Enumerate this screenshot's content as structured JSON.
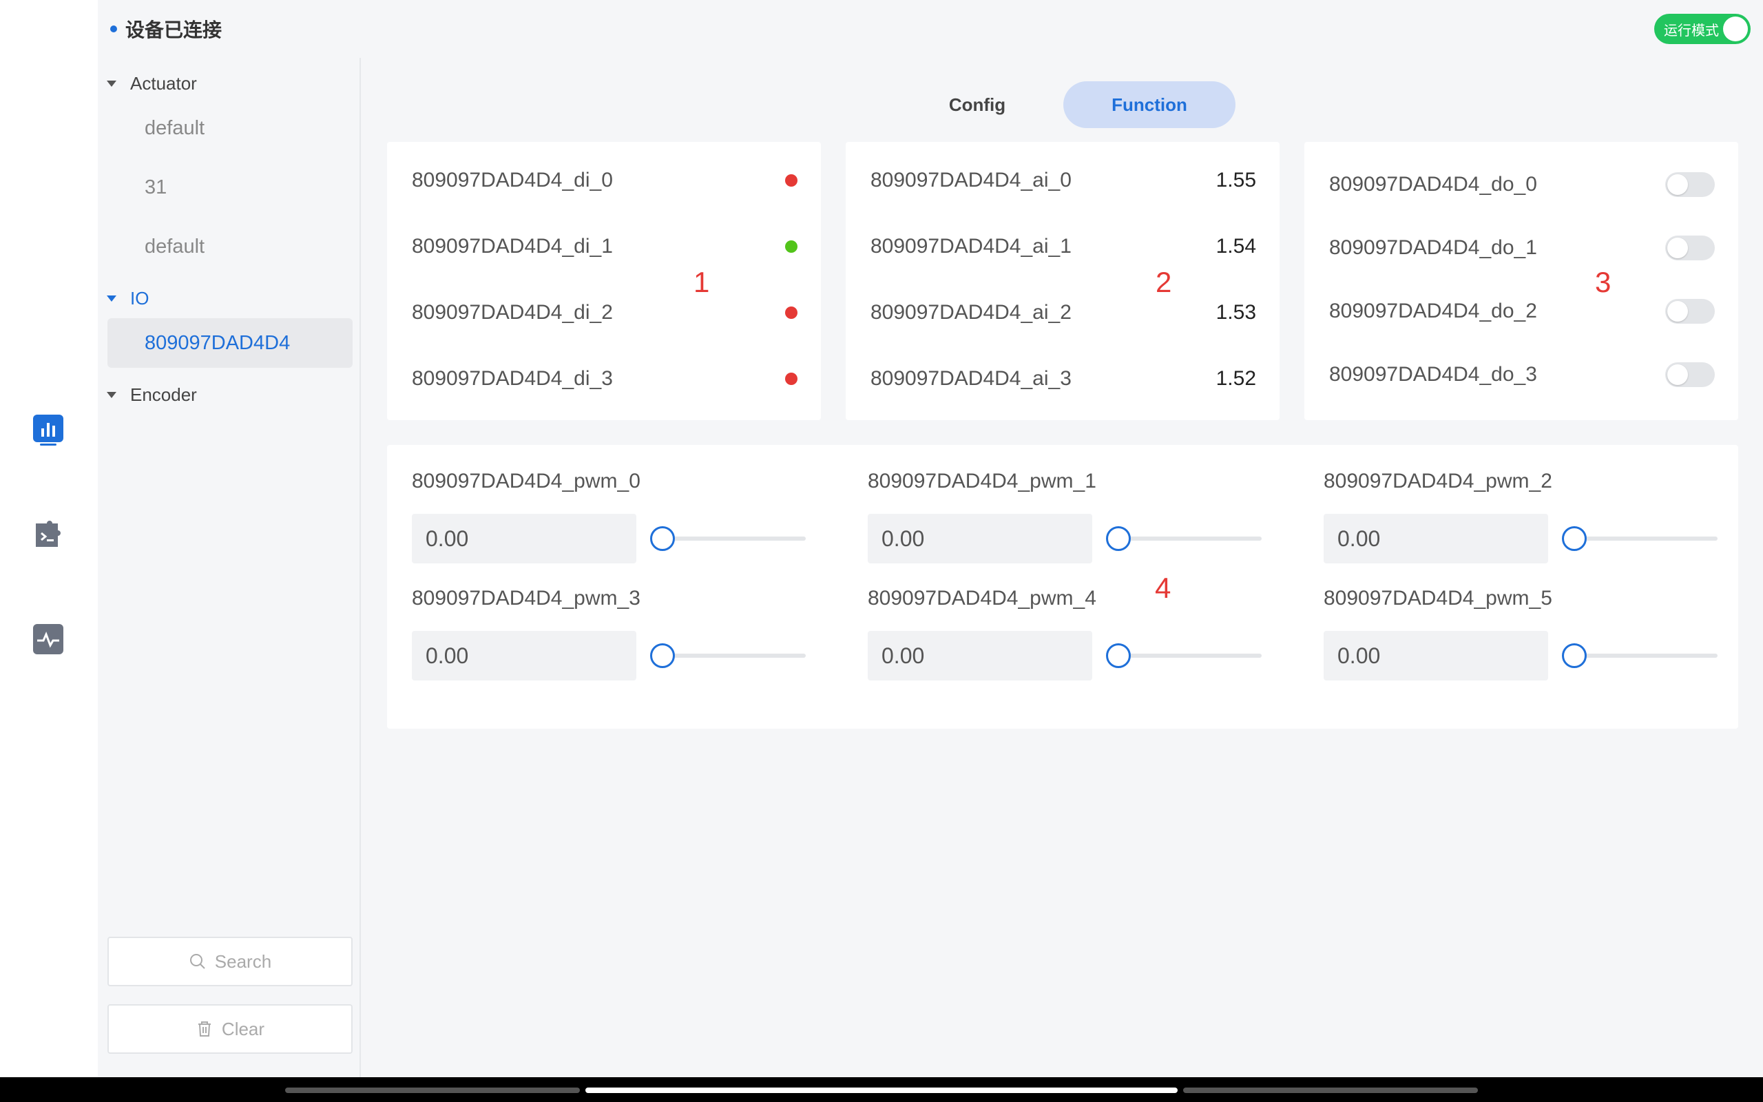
{
  "connection_status": "设备已连接",
  "mode_toggle_label": "运行模式",
  "tabs": [
    "Config",
    "Function"
  ],
  "tree": {
    "actuator_label": "Actuator",
    "actuator_items": [
      "default",
      "31",
      "default"
    ],
    "io_label": "IO",
    "io_items": [
      "809097DAD4D4"
    ],
    "encoder_label": "Encoder"
  },
  "sidebar_buttons": {
    "search": "Search",
    "clear": "Clear"
  },
  "di_panel": {
    "marker": "1",
    "rows": [
      {
        "name": "809097DAD4D4_di_0",
        "state": "red"
      },
      {
        "name": "809097DAD4D4_di_1",
        "state": "green"
      },
      {
        "name": "809097DAD4D4_di_2",
        "state": "red"
      },
      {
        "name": "809097DAD4D4_di_3",
        "state": "red"
      }
    ]
  },
  "ai_panel": {
    "marker": "2",
    "rows": [
      {
        "name": "809097DAD4D4_ai_0",
        "value": "1.55"
      },
      {
        "name": "809097DAD4D4_ai_1",
        "value": "1.54"
      },
      {
        "name": "809097DAD4D4_ai_2",
        "value": "1.53"
      },
      {
        "name": "809097DAD4D4_ai_3",
        "value": "1.52"
      }
    ]
  },
  "do_panel": {
    "marker": "3",
    "rows": [
      {
        "name": "809097DAD4D4_do_0",
        "on": false
      },
      {
        "name": "809097DAD4D4_do_1",
        "on": false
      },
      {
        "name": "809097DAD4D4_do_2",
        "on": false
      },
      {
        "name": "809097DAD4D4_do_3",
        "on": false
      }
    ]
  },
  "pwm_panel": {
    "marker": "4",
    "items": [
      {
        "name": "809097DAD4D4_pwm_0",
        "value": "0.00",
        "fraction": 0
      },
      {
        "name": "809097DAD4D4_pwm_1",
        "value": "0.00",
        "fraction": 0
      },
      {
        "name": "809097DAD4D4_pwm_2",
        "value": "0.00",
        "fraction": 0
      },
      {
        "name": "809097DAD4D4_pwm_3",
        "value": "0.00",
        "fraction": 0
      },
      {
        "name": "809097DAD4D4_pwm_4",
        "value": "0.00",
        "fraction": 0
      },
      {
        "name": "809097DAD4D4_pwm_5",
        "value": "0.00",
        "fraction": 0
      }
    ]
  },
  "colors": {
    "accent": "#1e6fd9",
    "led_red": "#e53935",
    "led_green": "#52c41a",
    "toggle_on": "#22c55e"
  },
  "rail_icons": [
    "chart-icon",
    "terminal-puzzle-icon",
    "activity-icon"
  ]
}
